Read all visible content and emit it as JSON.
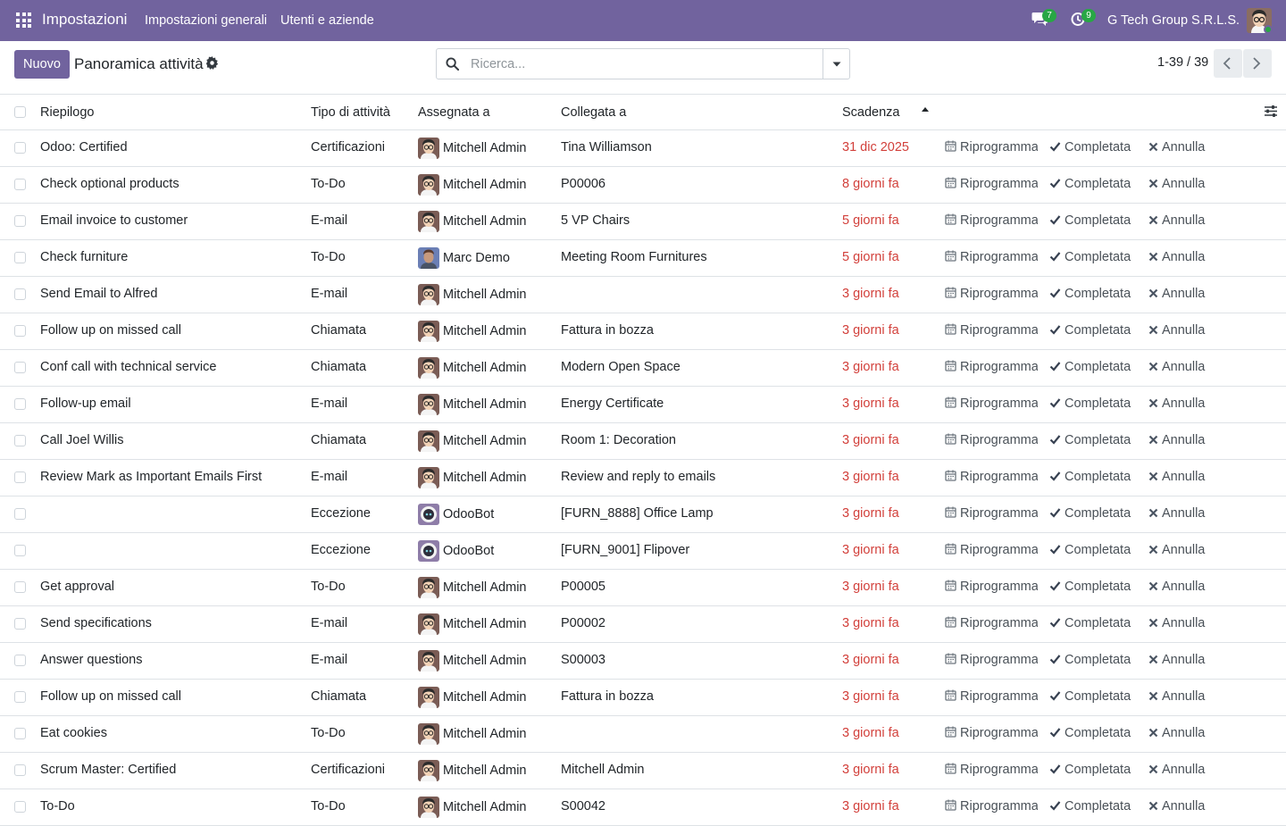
{
  "navbar": {
    "app_name": "Impostazioni",
    "menu": [
      "Impostazioni generali",
      "Utenti e aziende"
    ],
    "messages_badge": "7",
    "activities_badge": "9",
    "company": "G Tech Group S.R.L.S."
  },
  "control_panel": {
    "new_label": "Nuovo",
    "title": "Panoramica attività",
    "search_placeholder": "Ricerca...",
    "pager": "1-39 / 39"
  },
  "columns": {
    "summary": "Riepilogo",
    "type": "Tipo di attività",
    "assigned": "Assegnata a",
    "linked": "Collegata a",
    "deadline": "Scadenza"
  },
  "actions": {
    "reschedule": "Riprogramma",
    "done": "Completata",
    "cancel": "Annulla"
  },
  "colors": {
    "brand": "#71639e",
    "overdue": "#d23f3a",
    "online": "#28a745"
  },
  "rows": [
    {
      "summary": "Odoo: Certified",
      "type": "Certificazioni",
      "assigned": "Mitchell Admin",
      "avatar": "mitchell",
      "linked": "Tina Williamson",
      "deadline": "31 dic 2025"
    },
    {
      "summary": "Check optional products",
      "type": "To-Do",
      "assigned": "Mitchell Admin",
      "avatar": "mitchell",
      "linked": "P00006",
      "deadline": "8 giorni fa"
    },
    {
      "summary": "Email invoice to customer",
      "type": "E-mail",
      "assigned": "Mitchell Admin",
      "avatar": "mitchell",
      "linked": "5 VP Chairs",
      "deadline": "5 giorni fa"
    },
    {
      "summary": "Check furniture",
      "type": "To-Do",
      "assigned": "Marc Demo",
      "avatar": "marc",
      "linked": "Meeting Room Furnitures",
      "deadline": "5 giorni fa"
    },
    {
      "summary": "Send Email to Alfred",
      "type": "E-mail",
      "assigned": "Mitchell Admin",
      "avatar": "mitchell",
      "linked": "",
      "deadline": "3 giorni fa"
    },
    {
      "summary": "Follow up on missed call",
      "type": "Chiamata",
      "assigned": "Mitchell Admin",
      "avatar": "mitchell",
      "linked": "Fattura in bozza",
      "deadline": "3 giorni fa"
    },
    {
      "summary": "Conf call with technical service",
      "type": "Chiamata",
      "assigned": "Mitchell Admin",
      "avatar": "mitchell",
      "linked": "Modern Open Space",
      "deadline": "3 giorni fa"
    },
    {
      "summary": "Follow-up email",
      "type": "E-mail",
      "assigned": "Mitchell Admin",
      "avatar": "mitchell",
      "linked": "Energy Certificate",
      "deadline": "3 giorni fa"
    },
    {
      "summary": "Call Joel Willis",
      "type": "Chiamata",
      "assigned": "Mitchell Admin",
      "avatar": "mitchell",
      "linked": "Room 1: Decoration",
      "deadline": "3 giorni fa"
    },
    {
      "summary": "Review Mark as Important Emails First",
      "type": "E-mail",
      "assigned": "Mitchell Admin",
      "avatar": "mitchell",
      "linked": "Review and reply to emails",
      "deadline": "3 giorni fa"
    },
    {
      "summary": "",
      "type": "Eccezione",
      "assigned": "OdooBot",
      "avatar": "odoobot",
      "linked": "[FURN_8888] Office Lamp",
      "deadline": "3 giorni fa"
    },
    {
      "summary": "",
      "type": "Eccezione",
      "assigned": "OdooBot",
      "avatar": "odoobot",
      "linked": "[FURN_9001] Flipover",
      "deadline": "3 giorni fa"
    },
    {
      "summary": "Get approval",
      "type": "To-Do",
      "assigned": "Mitchell Admin",
      "avatar": "mitchell",
      "linked": "P00005",
      "deadline": "3 giorni fa"
    },
    {
      "summary": "Send specifications",
      "type": "E-mail",
      "assigned": "Mitchell Admin",
      "avatar": "mitchell",
      "linked": "P00002",
      "deadline": "3 giorni fa"
    },
    {
      "summary": "Answer questions",
      "type": "E-mail",
      "assigned": "Mitchell Admin",
      "avatar": "mitchell",
      "linked": "S00003",
      "deadline": "3 giorni fa"
    },
    {
      "summary": "Follow up on missed call",
      "type": "Chiamata",
      "assigned": "Mitchell Admin",
      "avatar": "mitchell",
      "linked": "Fattura in bozza",
      "deadline": "3 giorni fa"
    },
    {
      "summary": "Eat cookies",
      "type": "To-Do",
      "assigned": "Mitchell Admin",
      "avatar": "mitchell",
      "linked": "",
      "deadline": "3 giorni fa"
    },
    {
      "summary": "Scrum Master: Certified",
      "type": "Certificazioni",
      "assigned": "Mitchell Admin",
      "avatar": "mitchell",
      "linked": "Mitchell Admin",
      "deadline": "3 giorni fa"
    },
    {
      "summary": "To-Do",
      "type": "To-Do",
      "assigned": "Mitchell Admin",
      "avatar": "mitchell",
      "linked": "S00042",
      "deadline": "3 giorni fa"
    }
  ]
}
